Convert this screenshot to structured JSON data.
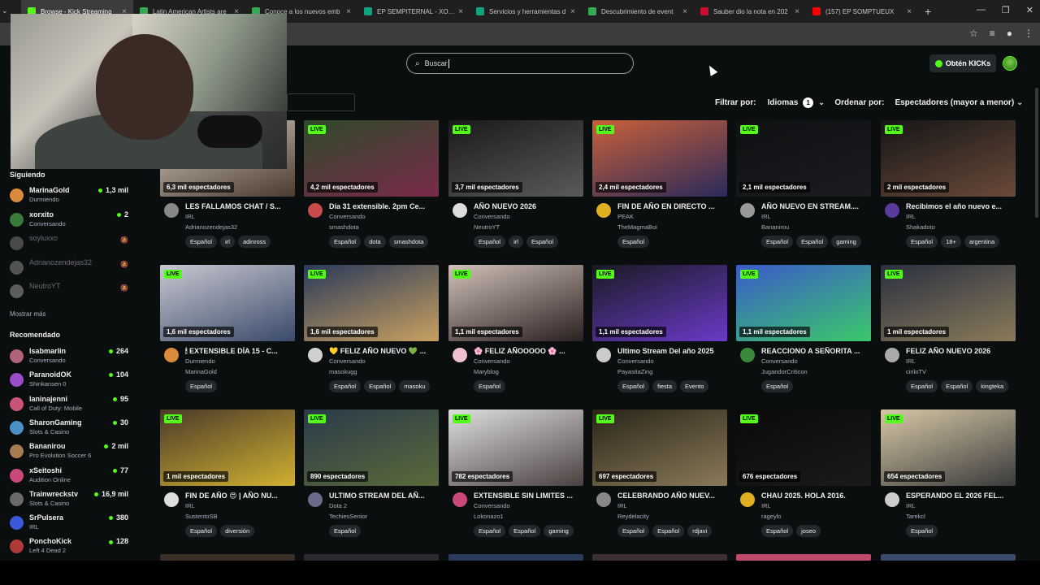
{
  "browser": {
    "tabs": [
      {
        "title": "Browse - Kick Streaming",
        "color": "#53fc18",
        "active": true
      },
      {
        "title": "Latin American Artists are",
        "color": "#34a853",
        "active": false
      },
      {
        "title": "Conoce a los nuevos emb",
        "color": "#34a853",
        "active": false
      },
      {
        "title": "EP SEMPITERNAL - XORXI",
        "color": "#10a37f",
        "active": false
      },
      {
        "title": "Servicios y herramientas d",
        "color": "#10a37f",
        "active": false
      },
      {
        "title": "Descubrimiento de event",
        "color": "#34a853",
        "active": false
      },
      {
        "title": "Sauber dio la nota en 202",
        "color": "#c8102e",
        "active": false
      },
      {
        "title": "(157) EP SOMPTUEUX",
        "color": "#ff0000",
        "active": false
      }
    ],
    "new_tab": "+",
    "window_controls": [
      "—",
      "❐",
      "✕"
    ]
  },
  "header": {
    "search_placeholder": "Buscar",
    "search_value": "Buscar",
    "kicks_label": "Obtén KICKs"
  },
  "filters": {
    "filter_label": "Filtrar por:",
    "languages_label": "Idiomas",
    "languages_count": "1",
    "sort_label": "Ordenar por:",
    "sort_value": "Espectadores (mayor a menor)"
  },
  "sidebar": {
    "following_heading": "Siguiendo",
    "following": [
      {
        "name": "MarinaGold",
        "sub": "Durmiendo",
        "count": "1,3 mil",
        "online": true,
        "color": "#d98a3a"
      },
      {
        "name": "xorxito",
        "sub": "Conversando",
        "count": "2",
        "online": true,
        "color": "#3a7a3a"
      },
      {
        "name": "soyluxxo",
        "sub": "",
        "count": "",
        "online": false,
        "color": "#888"
      },
      {
        "name": "Adrianozendejas32",
        "sub": "",
        "count": "",
        "online": false,
        "color": "#999"
      },
      {
        "name": "NeutroYT",
        "sub": "",
        "count": "",
        "online": false,
        "color": "#aaa"
      }
    ],
    "show_more": "Mostrar más",
    "recommended_heading": "Recomendado",
    "recommended": [
      {
        "name": "Isabmarlin",
        "sub": "Conversando",
        "count": "264",
        "color": "#b0647a"
      },
      {
        "name": "ParanoidOK",
        "sub": "Shinkansen 0",
        "count": "104",
        "color": "#9b4dca"
      },
      {
        "name": "laninajenni",
        "sub": "Call of Duty: Mobile",
        "count": "95",
        "color": "#c9547a"
      },
      {
        "name": "SharonGaming",
        "sub": "Slots & Casino",
        "count": "30",
        "color": "#4a90c9"
      },
      {
        "name": "Bananirou",
        "sub": "Pro Evolution Soccer 6",
        "count": "2 mil",
        "color": "#a67c52"
      },
      {
        "name": "xSeitoshi",
        "sub": "Audition Online",
        "count": "77",
        "color": "#c94a7a"
      },
      {
        "name": "Trainwreckstv",
        "sub": "Slots & Casino",
        "count": "16,9 mil",
        "color": "#6a6a6a"
      },
      {
        "name": "SrPulsera",
        "sub": "IRL",
        "count": "380",
        "color": "#3a5ad9"
      },
      {
        "name": "PonchoKick",
        "sub": "Left 4 Dead 2",
        "count": "128",
        "color": "#b03a3a"
      }
    ]
  },
  "cards": [
    {
      "viewers": "6,3 mil espectadores",
      "title": "LES FALLAMOS CHAT / S...",
      "category": "IRL",
      "user": "Adrianozendejas32",
      "tags": [
        "Español",
        "irl",
        "adinross"
      ],
      "bg1": "#d9d0c4",
      "bg2": "#4a3a30",
      "av": "#888"
    },
    {
      "viewers": "4,2 mil espectadores",
      "title": "Día 31 extensible. 2pm Ce...",
      "category": "Conversando",
      "user": "smashdota",
      "tags": [
        "Español",
        "dota",
        "smashdota"
      ],
      "bg1": "#2f4a2a",
      "bg2": "#7a2a4a",
      "av": "#c94a4a"
    },
    {
      "viewers": "3,7 mil espectadores",
      "title": "AÑO NUEVO 2026",
      "category": "Conversando",
      "user": "NeutroYT",
      "tags": [
        "Español",
        "irl",
        "Español"
      ],
      "bg1": "#1a1a1a",
      "bg2": "#5a5a5a",
      "av": "#ddd"
    },
    {
      "viewers": "2,4 mil espectadores",
      "title": "FIN DE AÑO EN DIRECTO ...",
      "category": "PEAK",
      "user": "TheMagmaBoi",
      "tags": [
        "Español"
      ],
      "bg1": "#c9603a",
      "bg2": "#2a2a5a",
      "av": "#e0b020"
    },
    {
      "viewers": "2,1 mil espectadores",
      "title": "AÑO NUEVO EN STREAM....",
      "category": "IRL",
      "user": "Bananirou",
      "tags": [
        "Español",
        "Español",
        "gaming"
      ],
      "bg1": "#0f1012",
      "bg2": "#1a1c20",
      "av": "#999"
    },
    {
      "viewers": "2 mil espectadores",
      "title": "Recibimos el año nuevo e...",
      "category": "IRL",
      "user": "Shakadoto",
      "tags": [
        "Español",
        "18+",
        "argentina"
      ],
      "bg1": "#151515",
      "bg2": "#6a4a3a",
      "av": "#5a3a9a"
    },
    {
      "viewers": "1,6 mil espectadores",
      "title": "🕯 EXTENSIBLE DÍA 15 - C...",
      "category": "Durmiendo",
      "user": "MarinaGold",
      "tags": [
        "Español"
      ],
      "bg1": "#c8c8d0",
      "bg2": "#3a4a6a",
      "av": "#d98a3a"
    },
    {
      "viewers": "1,6 mil espectadores",
      "title": "💛 FELIZ AÑO NUEVO 💚 ...",
      "category": "Conversando",
      "user": "masokugg",
      "tags": [
        "Español",
        "Español",
        "masoku"
      ],
      "bg1": "#2a3a5a",
      "bg2": "#c8a060",
      "av": "#d0d0d0"
    },
    {
      "viewers": "1,1 mil espectadores",
      "title": "🌸 FELIZ AÑOOOOO 🌸 ...",
      "category": "Conversando",
      "user": "Maryblog",
      "tags": [
        "Español"
      ],
      "bg1": "#d0c0b8",
      "bg2": "#2a2020",
      "av": "#f0c0d0"
    },
    {
      "viewers": "1,1 mil espectadores",
      "title": "Ultimo Stream Del año 2025",
      "category": "Conversando",
      "user": "PayasitaZing",
      "tags": [
        "Español",
        "fiesta",
        "Evento"
      ],
      "bg1": "#1a1a22",
      "bg2": "#6a3ac9",
      "av": "#ccc"
    },
    {
      "viewers": "1,1 mil espectadores",
      "title": "REACCIONO A SEÑORITA ...",
      "category": "Conversando",
      "user": "JugandorCriticon",
      "tags": [
        "Español"
      ],
      "bg1": "#3a5ac9",
      "bg2": "#3ac96a",
      "av": "#3a8a3a"
    },
    {
      "viewers": "1 mil espectadores",
      "title": "FELIZ AÑO NUEVO 2026",
      "category": "IRL",
      "user": "cirilоTV",
      "tags": [
        "Español",
        "Español",
        "kingteka"
      ],
      "bg1": "#2a3040",
      "bg2": "#8a7a5a",
      "av": "#aaa"
    },
    {
      "viewers": "1 mil espectadores",
      "title": "FIN DE AÑO 😍 | AÑO NU...",
      "category": "IRL",
      "user": "SustentoSB",
      "tags": [
        "Español",
        "diversión"
      ],
      "bg1": "#4a3a2a",
      "bg2": "#d0b030",
      "av": "#ddd"
    },
    {
      "viewers": "890 espectadores",
      "title": "ULTIMO STREAM DEL AÑ...",
      "category": "Dota 2",
      "user": "TechiesSenior",
      "tags": [
        "Español"
      ],
      "bg1": "#2a3a4a",
      "bg2": "#5a6a3a",
      "av": "#6a6a8a"
    },
    {
      "viewers": "782 espectadores",
      "title": "EXTENSIBLE SIN LIMITES ...",
      "category": "Conversando",
      "user": "Lokonazo1",
      "tags": [
        "Español",
        "Español",
        "gaming"
      ],
      "bg1": "#e0e0e0",
      "bg2": "#4a4040",
      "av": "#c94a7a"
    },
    {
      "viewers": "697 espectadores",
      "title": "CELEBRANDO AÑO NUEV...",
      "category": "IRL",
      "user": "Reydelacity",
      "tags": [
        "Español",
        "Español",
        "rdjavi"
      ],
      "bg1": "#2a2418",
      "bg2": "#8a7a5a",
      "av": "#888"
    },
    {
      "viewers": "676 espectadores",
      "title": "CHAU 2025. HOLA 2016.",
      "category": "IRL",
      "user": "rageylo",
      "tags": [
        "Español",
        "joseo"
      ],
      "bg1": "#0a0a0a",
      "bg2": "#1a1a1a",
      "av": "#e0b020"
    },
    {
      "viewers": "654 espectadores",
      "title": "ESPERANDO EL 2026 FEL...",
      "category": "IRL",
      "user": "Tarekcl",
      "tags": [
        "Español"
      ],
      "bg1": "#d8c8a8",
      "bg2": "#3a3a3a",
      "av": "#ccc"
    }
  ],
  "live_label": "LIVE"
}
